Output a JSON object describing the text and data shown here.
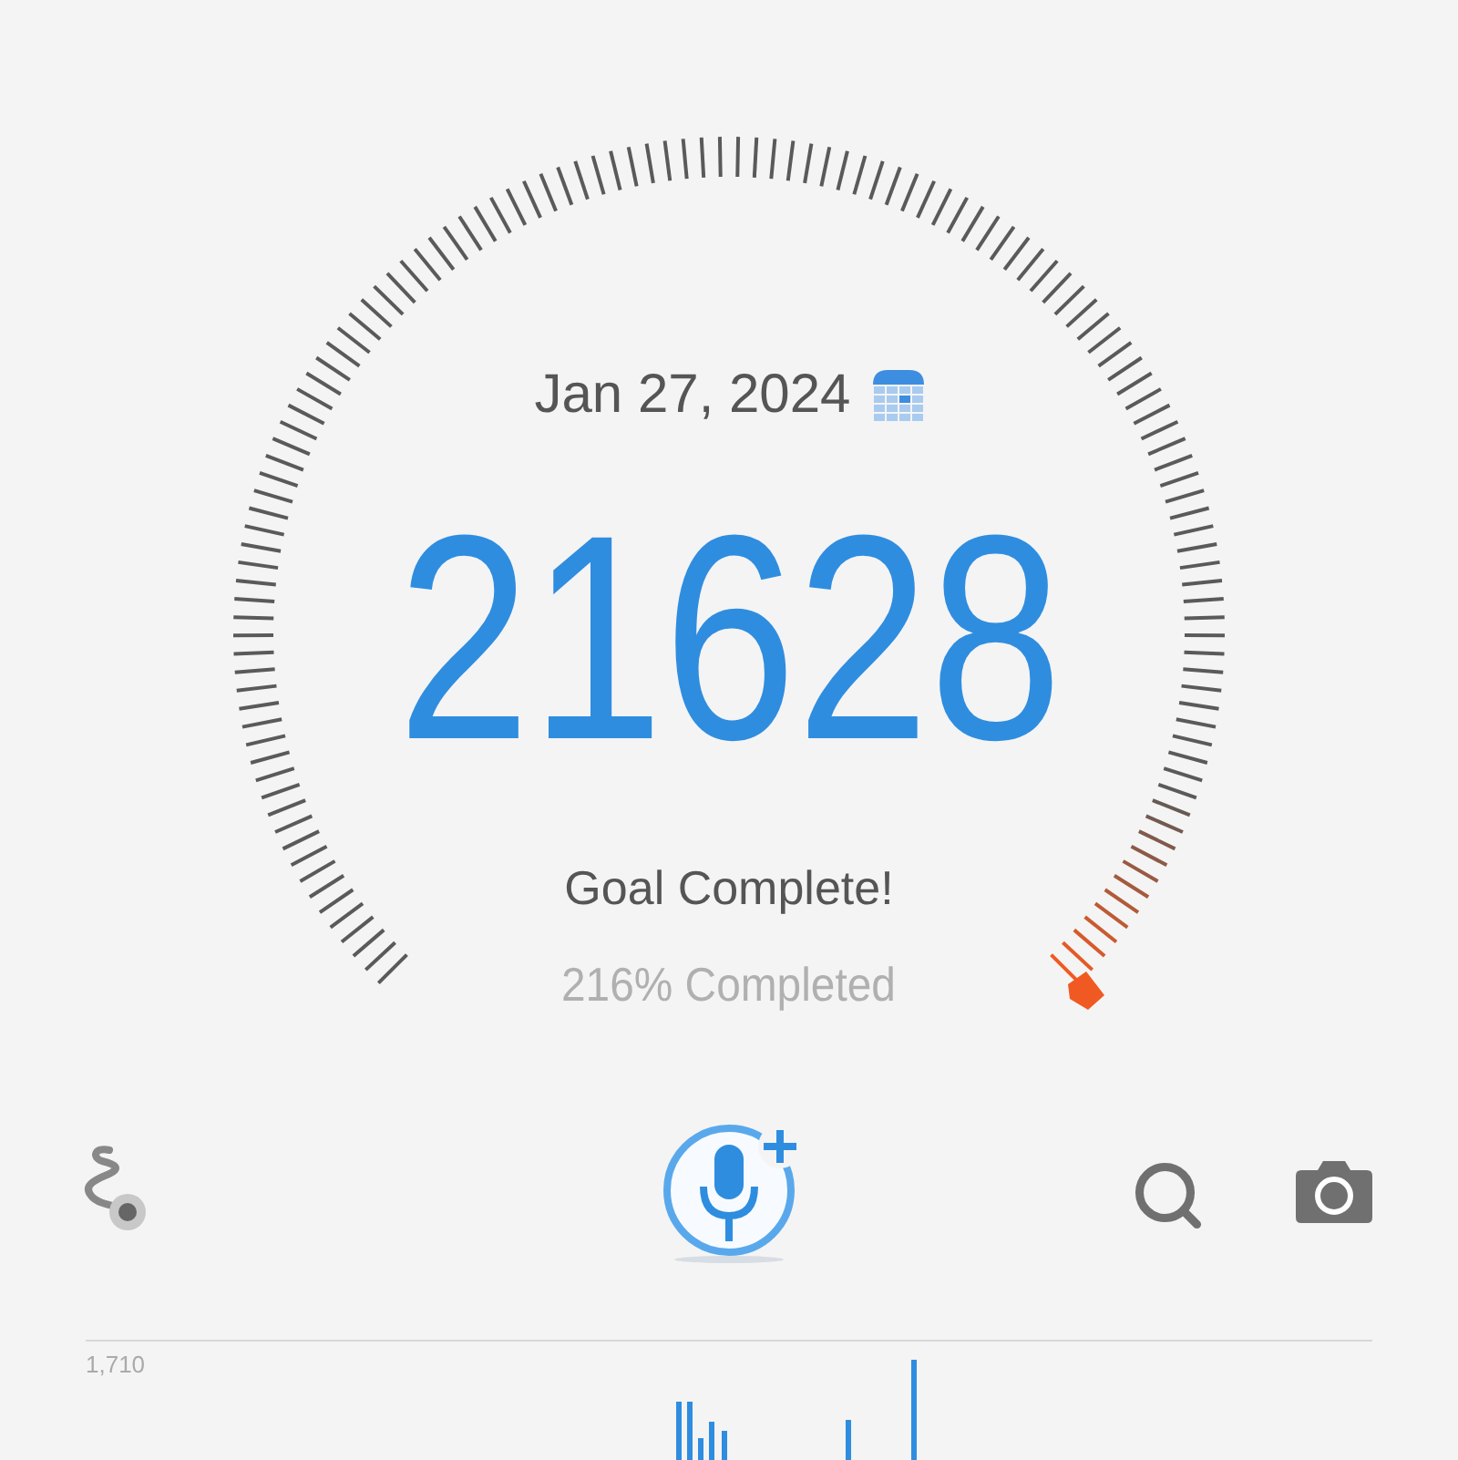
{
  "date": "Jan 27, 2024",
  "steps": "21628",
  "status": "Goal Complete!",
  "progress": "216% Completed",
  "chart": {
    "axis_label": "1,710"
  }
}
